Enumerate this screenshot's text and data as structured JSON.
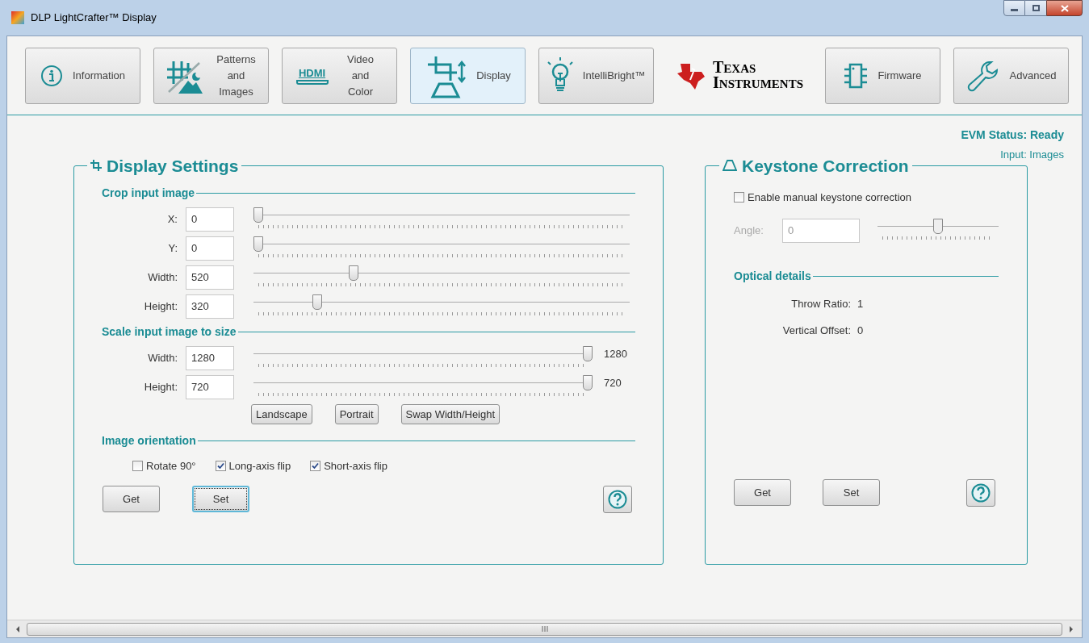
{
  "window": {
    "title": "DLP LightCrafter™ Display"
  },
  "toolbar": [
    {
      "kind": "button",
      "label": "Information",
      "selected": false
    },
    {
      "kind": "button",
      "label": "Patterns and Images",
      "selected": false
    },
    {
      "kind": "button",
      "label": "Video and Color",
      "icon_text": "HDMI",
      "selected": false
    },
    {
      "kind": "button",
      "label": "Display",
      "selected": true
    },
    {
      "kind": "button",
      "label": "IntelliBright™",
      "selected": false
    },
    {
      "kind": "logo",
      "lines": [
        "TEXAS",
        "INSTRUMENTS"
      ]
    },
    {
      "kind": "button",
      "label": "Firmware",
      "selected": false
    },
    {
      "kind": "button",
      "label": "Advanced",
      "selected": false
    }
  ],
  "status": {
    "evm": "EVM Status: Ready",
    "input": "Input: Images"
  },
  "display_settings": {
    "title": "Display Settings",
    "crop": {
      "heading": "Crop input image",
      "rows": [
        {
          "label": "X:",
          "value": "0",
          "level": 0
        },
        {
          "label": "Y:",
          "value": "0",
          "level": 0
        },
        {
          "label": "Width:",
          "value": "520",
          "level": 0.26
        },
        {
          "label": "Height:",
          "value": "320",
          "level": 0.16
        }
      ]
    },
    "scale": {
      "heading": "Scale input image to size",
      "rows": [
        {
          "label": "Width:",
          "value": "1280",
          "level": 1,
          "reading": "1280"
        },
        {
          "label": "Height:",
          "value": "720",
          "level": 1,
          "reading": "720"
        }
      ],
      "buttons": [
        "Landscape",
        "Portrait",
        "Swap Width/Height"
      ]
    },
    "orientation": {
      "heading": "Image orientation",
      "options": [
        {
          "label": "Rotate 90°",
          "checked": false
        },
        {
          "label": "Long-axis flip",
          "checked": true
        },
        {
          "label": "Short-axis flip",
          "checked": true
        }
      ]
    },
    "actions": [
      {
        "label": "Get",
        "focused": false
      },
      {
        "label": "Set",
        "focused": true
      }
    ]
  },
  "keystone": {
    "title": "Keystone Correction",
    "enable": {
      "label": "Enable manual keystone correction",
      "checked": false
    },
    "angle": {
      "label": "Angle:",
      "value": "0",
      "level": 0.5,
      "disabled": true
    },
    "optical": {
      "heading": "Optical details",
      "rows": [
        {
          "label": "Throw Ratio:",
          "value": "1"
        },
        {
          "label": "Vertical Offset:",
          "value": "0"
        }
      ]
    },
    "actions": [
      {
        "label": "Get",
        "focused": false
      },
      {
        "label": "Set",
        "focused": false
      }
    ]
  }
}
